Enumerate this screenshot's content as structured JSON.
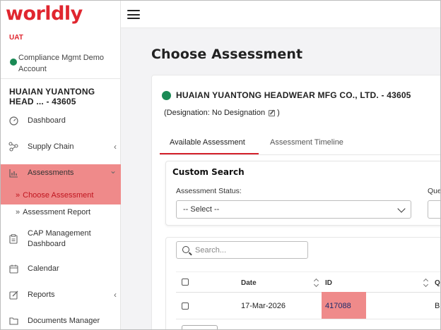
{
  "brand": {
    "logo_text": "worldly",
    "accent": "#e0262f"
  },
  "sidebar": {
    "env_label": "UAT",
    "account_name": "Compliance Mgmt Demo Account",
    "company": "HUAIAN YUANTONG HEAD ... - 43605",
    "items": [
      {
        "label": "Dashboard",
        "icon": "dashboard-icon"
      },
      {
        "label": "Supply Chain",
        "icon": "supply-chain-icon",
        "chevron": "‹"
      },
      {
        "label": "Assessments",
        "icon": "bar-chart-icon",
        "chevron": "⌄"
      },
      {
        "label": "CAP Management Dashboard",
        "icon": "clipboard-icon"
      },
      {
        "label": "Calendar",
        "icon": "calendar-icon"
      },
      {
        "label": "Reports",
        "icon": "edit-icon",
        "chevron": "‹"
      },
      {
        "label": "Documents Manager",
        "icon": "folder-icon"
      }
    ],
    "sub_items": [
      {
        "label": "Choose Assessment",
        "arrow": "»"
      },
      {
        "label": "Assessment Report",
        "arrow": "»"
      }
    ]
  },
  "main": {
    "title": "Choose Assessment",
    "org_name": "HUAIAN YUANTONG HEADWEAR MFG CO., LTD. - 43605",
    "designation_open": "(Designation: No Designation",
    "designation_close": ")",
    "tabs": [
      {
        "label": "Available Assessment",
        "active": true
      },
      {
        "label": "Assessment Timeline",
        "active": false
      }
    ],
    "custom_search": {
      "title": "Custom Search",
      "status_label": "Assessment Status:",
      "status_value": "-- Select --",
      "second_label": "Que"
    },
    "table": {
      "search_placeholder": "Search...",
      "columns": [
        "Date",
        "ID",
        "Q"
      ],
      "rows": [
        {
          "date": "17-Mar-2026",
          "id": "417088",
          "third": "B"
        }
      ]
    }
  }
}
